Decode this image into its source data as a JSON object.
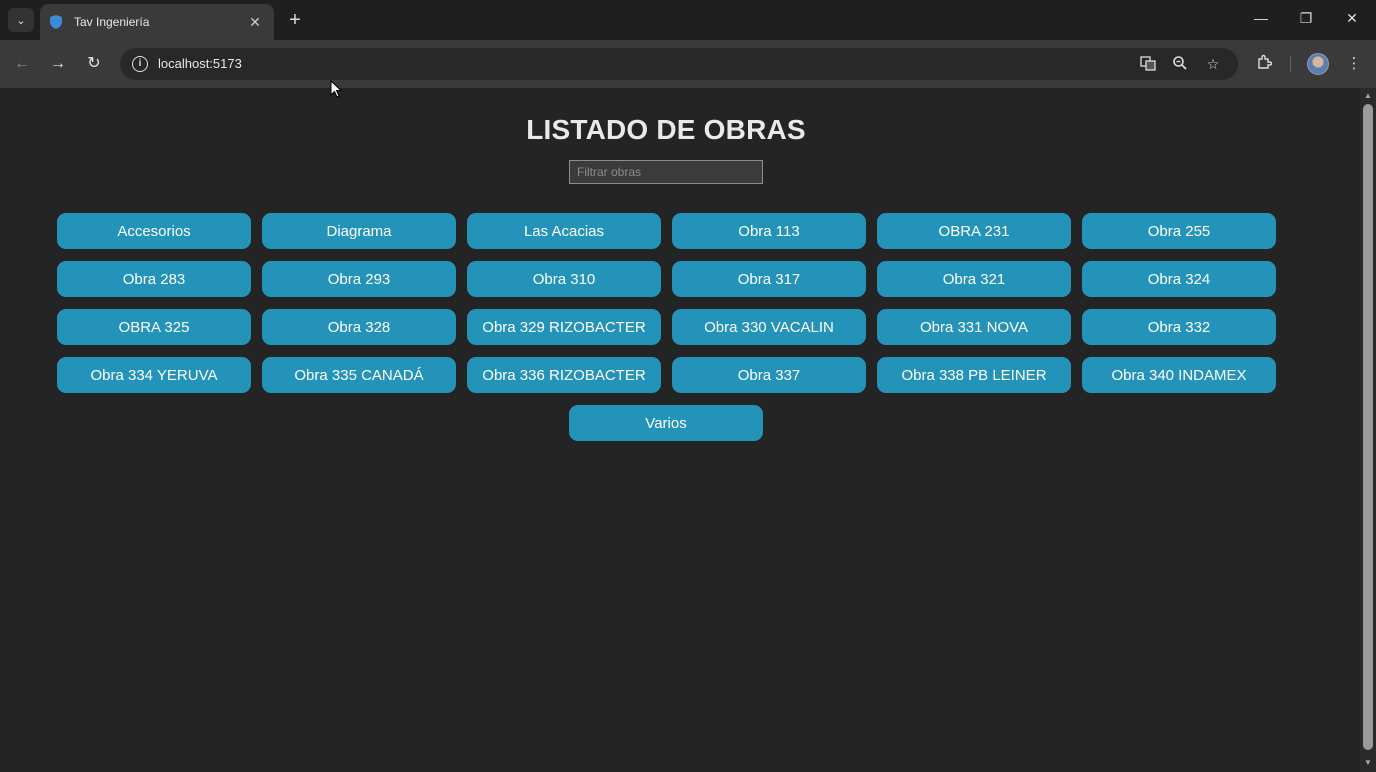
{
  "browser": {
    "tab_title": "Tav Ingeniería",
    "url": "localhost:5173"
  },
  "page": {
    "title": "LISTADO DE OBRAS",
    "filter_placeholder": "Filtrar obras",
    "obras": [
      "Accesorios",
      "Diagrama",
      "Las Acacias",
      "Obra 113",
      "OBRA 231",
      "Obra 255",
      "Obra 283",
      "Obra 293",
      "Obra 310",
      "Obra 317",
      "Obra 321",
      "Obra 324",
      "OBRA 325",
      "Obra 328",
      "Obra 329 RIZOBACTER",
      "Obra 330 VACALIN",
      "Obra 331 NOVA",
      "Obra 332",
      "Obra 334 YERUVA",
      "Obra 335 CANADÁ",
      "Obra 336 RIZOBACTER",
      "Obra 337",
      "Obra 338 PB LEINER",
      "Obra 340 INDAMEX"
    ],
    "last_obra": "Varios"
  },
  "colors": {
    "button_bg": "#2493b9",
    "page_bg": "#242424"
  }
}
